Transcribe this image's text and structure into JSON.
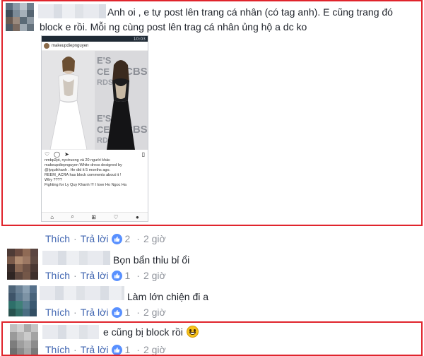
{
  "post": {
    "author_blurred": true,
    "text_line1": "Anh oi , e tự post lên trang cá nhân (có tag anh). E cũng trang đó",
    "text_line2": "block e rồi. Mỗi ng cùng post lên trag cá nhân ủng hộ a dc ko",
    "screenshot": {
      "status_time": "10:03",
      "account": "makeupdiepnguyen",
      "likes_line": "nmbp2pt, nyctruong và 20 người khác",
      "caption_lines": [
        "makeupdiepnguyen White dress designed by",
        "@lyquikhanh . He did it 5 months ago.",
        "REEM_ACRA has block comments about it !",
        "Why ????",
        "Fighting for Ly Quy Khanh !!! I love Ho Ngoc Ha"
      ],
      "backdrop_text": [
        "E'S",
        "CE",
        "RDS",
        "CBS",
        "E'S",
        "CE",
        "RDS",
        "CBS"
      ]
    },
    "actions": {
      "like_label": "Thích",
      "reply_label": "Trả lời",
      "like_count": "2",
      "time": "2 giờ"
    }
  },
  "replies": [
    {
      "text": "Bọn bẩn thỉu bỉ ổi",
      "actions": {
        "like_label": "Thích",
        "reply_label": "Trả lời",
        "like_count": "1",
        "time": "2 giờ"
      }
    },
    {
      "text": "Làm lớn chiện đi a",
      "actions": {
        "like_label": "Thích",
        "reply_label": "Trả lời",
        "like_count": "1",
        "time": "2 giờ"
      }
    },
    {
      "text": "e cũng bị block rồi",
      "emoji": "smiley-emoji",
      "actions": {
        "like_label": "Thích",
        "reply_label": "Trả lời",
        "like_count": "1",
        "time": "2 giờ"
      }
    }
  ],
  "colors": {
    "link": "#4267b2",
    "meta": "#90949c",
    "highlight_border": "#e0242c",
    "like_icon": "#5890ff"
  },
  "icons": {
    "like": "thumbs-up-icon",
    "emoji": "smiley-emoji",
    "ig_actions": [
      "heart-icon",
      "comment-icon",
      "share-icon",
      "bookmark-icon"
    ],
    "ig_nav": [
      "home-icon",
      "search-icon",
      "add-icon",
      "heart-icon",
      "profile-icon"
    ]
  }
}
